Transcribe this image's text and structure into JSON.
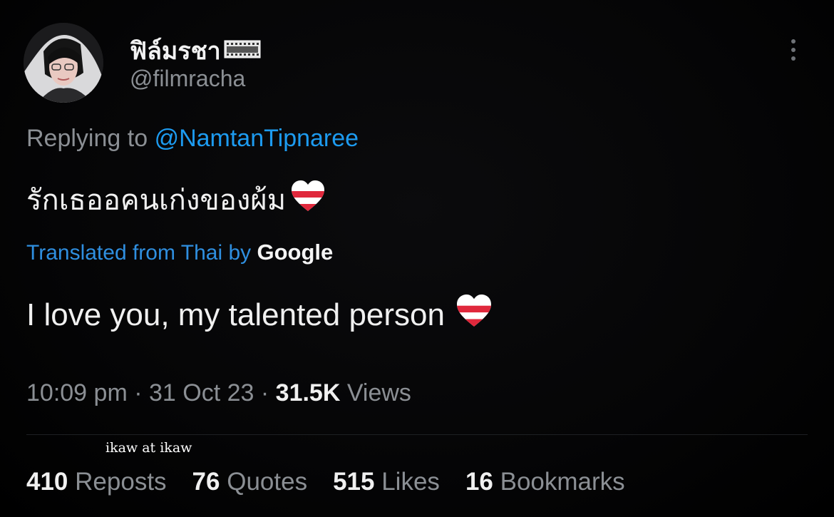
{
  "colors": {
    "background": "#000000",
    "primary_text": "#e7e9ea",
    "secondary_text": "#8b8f94",
    "link": "#1d9bf0",
    "heart_red": "#e0283c"
  },
  "tweet": {
    "display_name": "ฟิล์มรชา",
    "display_name_icon": "film-strip-icon",
    "handle": "@filmracha",
    "replying_prefix": "Replying to",
    "replying_handle": "@NamtanTipnaree",
    "text_thai": "รักเธออคนเก่งของผ้ม",
    "translated_label": "Translated from Thai by",
    "translated_provider": "Google",
    "text_english": "I love you, my talented person",
    "emoji_icon": "white-red-heart-icon",
    "time": "10:09 pm",
    "date": "31 Oct 23",
    "views_count": "31.5K",
    "views_label": "Views",
    "overlay_caption": "ikaw at ikaw",
    "stats": {
      "reposts": {
        "count": "410",
        "label": "Reposts"
      },
      "quotes": {
        "count": "76",
        "label": "Quotes"
      },
      "likes": {
        "count": "515",
        "label": "Likes"
      },
      "bookmarks": {
        "count": "16",
        "label": "Bookmarks"
      }
    }
  }
}
